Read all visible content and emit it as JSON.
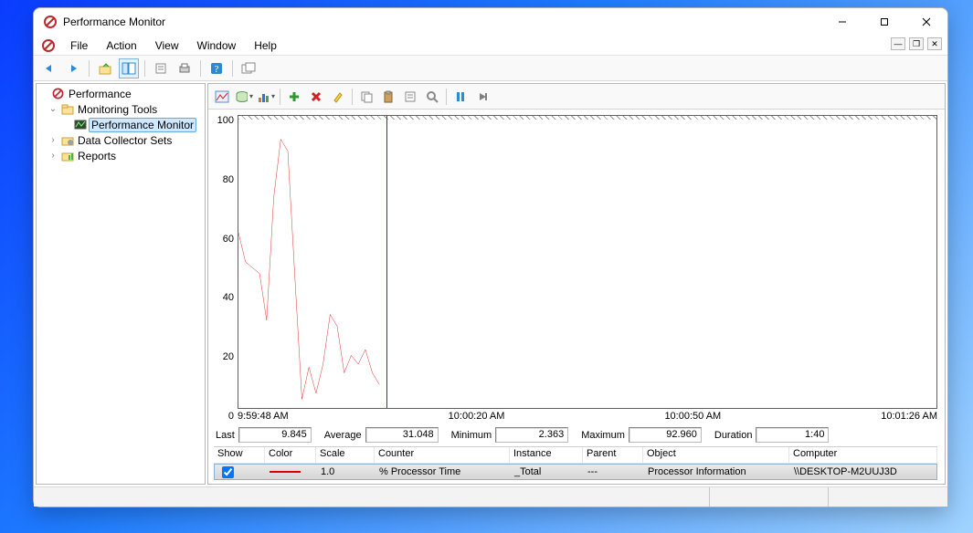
{
  "app": {
    "title": "Performance Monitor"
  },
  "menu": {
    "file": "File",
    "action": "Action",
    "view": "View",
    "window": "Window",
    "help": "Help"
  },
  "tree": {
    "root": "Performance",
    "monitoring": "Monitoring Tools",
    "perfmon": "Performance Monitor",
    "datacoll": "Data Collector Sets",
    "reports": "Reports"
  },
  "chart_data": {
    "type": "line",
    "ylim": [
      0,
      100
    ],
    "yticks": [
      100,
      80,
      60,
      40,
      20,
      0
    ],
    "xticks": [
      "9:59:48 AM",
      "10:00:20 AM",
      "10:00:50 AM",
      "10:01:26 AM"
    ],
    "series": [
      {
        "name": "% Processor Time",
        "color": "#d00000",
        "x": [
          0,
          1,
          2,
          3,
          4,
          5,
          6,
          7,
          8,
          9,
          10,
          11,
          12,
          13,
          14,
          15,
          16,
          17,
          18,
          19,
          20
        ],
        "values": [
          60,
          50,
          48,
          46,
          30,
          72,
          92,
          88,
          45,
          3,
          14,
          5,
          15,
          32,
          28,
          12,
          18,
          15,
          20,
          12,
          8
        ]
      }
    ],
    "x_total_slots": 100,
    "cursor_slot": 21,
    "title": "",
    "xlabel": "",
    "ylabel": ""
  },
  "stats": {
    "last_label": "Last",
    "last": "9.845",
    "avg_label": "Average",
    "avg": "31.048",
    "min_label": "Minimum",
    "min": "2.363",
    "max_label": "Maximum",
    "max": "92.960",
    "dur_label": "Duration",
    "dur": "1:40"
  },
  "counters": {
    "headers": {
      "show": "Show",
      "color": "Color",
      "scale": "Scale",
      "counter": "Counter",
      "instance": "Instance",
      "parent": "Parent",
      "object": "Object",
      "computer": "Computer"
    },
    "row": {
      "scale": "1.0",
      "counter": "% Processor Time",
      "instance": "_Total",
      "parent": "---",
      "object": "Processor Information",
      "computer": "\\\\DESKTOP-M2UUJ3D"
    }
  }
}
